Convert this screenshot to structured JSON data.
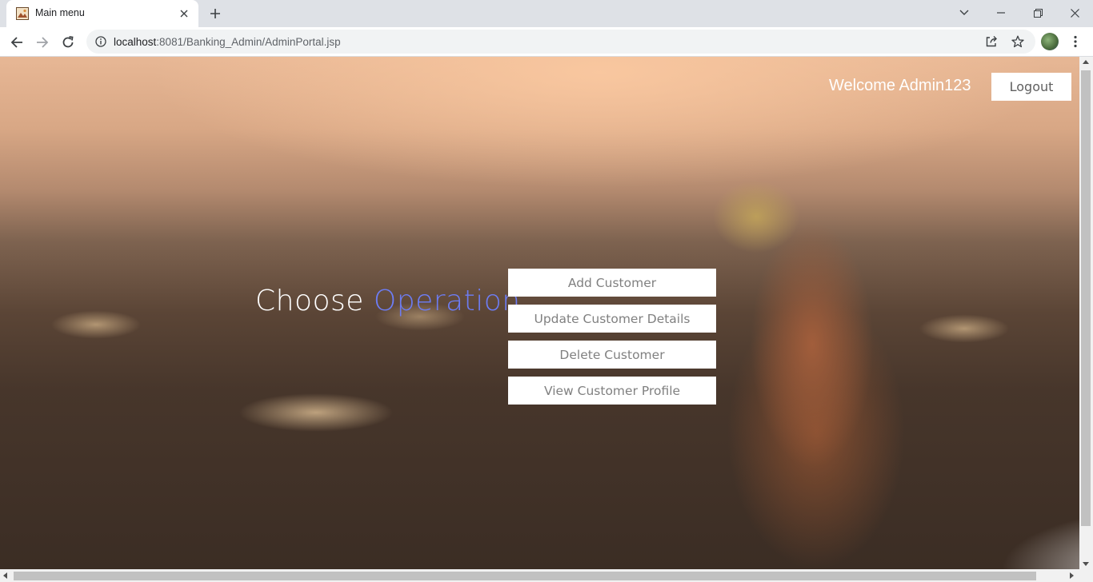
{
  "browser": {
    "tab": {
      "title": "Main menu",
      "favicon": "image-favicon-icon"
    },
    "new_tab_icon": "plus-icon",
    "window_controls": [
      "chevron-down-icon",
      "minimize-icon",
      "restore-icon",
      "close-icon"
    ],
    "address": {
      "host": "localhost",
      "path": ":8081/Banking_Admin/AdminPortal.jsp",
      "info_icon": "info-icon"
    },
    "toolbar_icons": [
      "back-arrow-icon",
      "forward-arrow-icon",
      "reload-icon",
      "share-icon",
      "star-icon",
      "profile-avatar",
      "kebab-menu-icon"
    ]
  },
  "page": {
    "welcome_text": "Welcome Admin123",
    "logout_label": "Logout",
    "heading": {
      "lead": "Choose",
      "accent": "Operation"
    },
    "accent_color": "#6d7df5",
    "operations": [
      {
        "label": "Add Customer"
      },
      {
        "label": "Update Customer Details"
      },
      {
        "label": "Delete Customer"
      },
      {
        "label": "View Customer Profile"
      }
    ]
  }
}
